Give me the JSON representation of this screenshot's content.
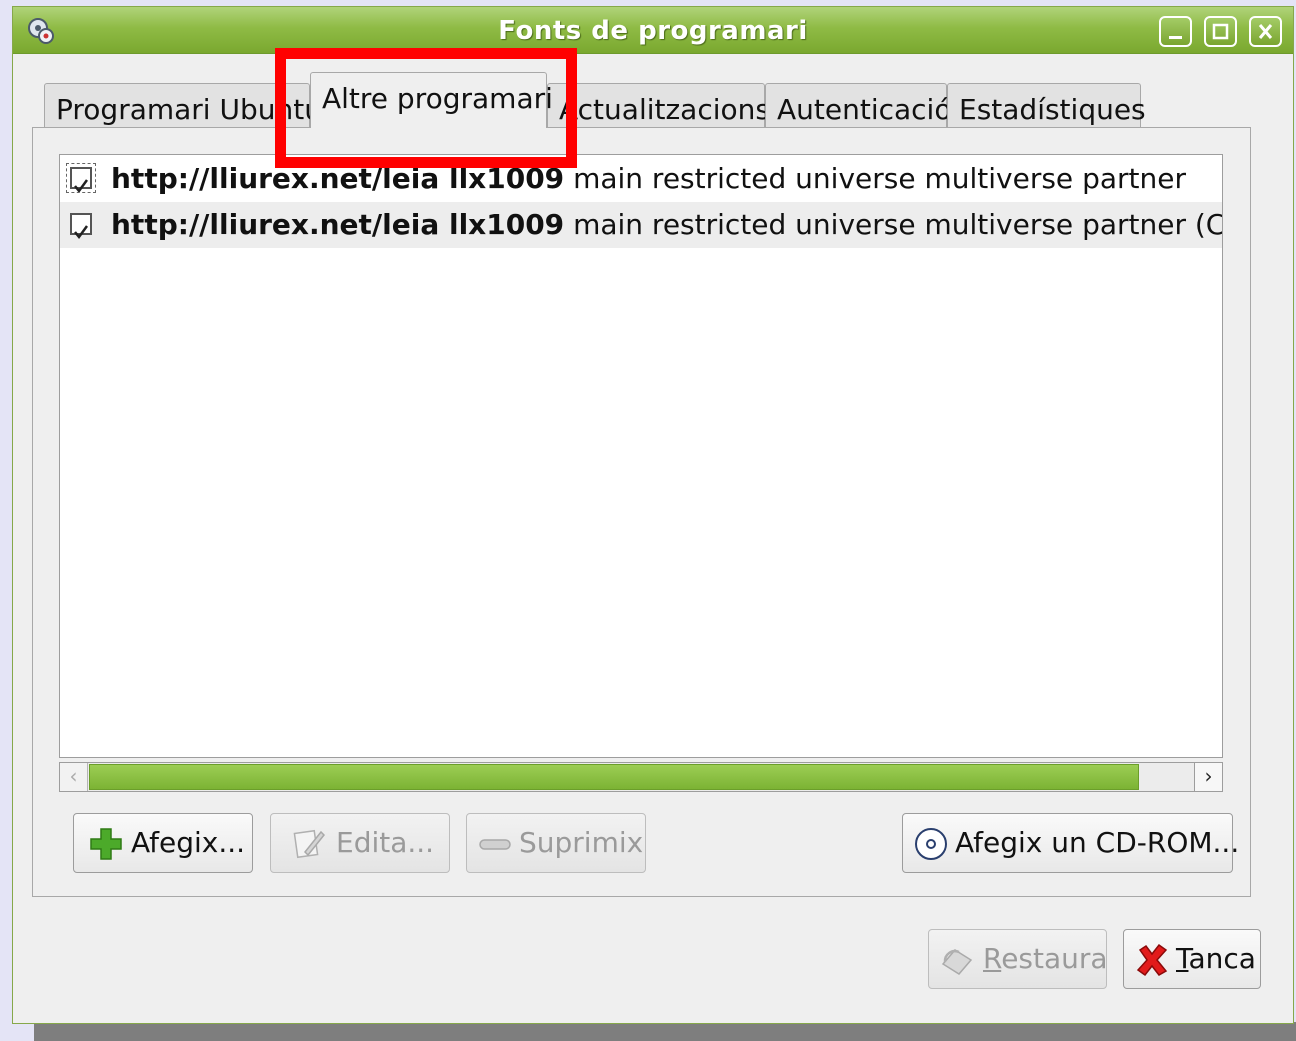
{
  "window": {
    "title": "Fonts de programari"
  },
  "tabs": [
    {
      "label": "Programari Ubuntu"
    },
    {
      "label": "Altre programari",
      "active": true
    },
    {
      "label": "Actualitzacions"
    },
    {
      "label": "Autenticació"
    },
    {
      "label": "Estadístiques"
    }
  ],
  "sources": [
    {
      "checked": true,
      "url": "http://lliurex.net/leia llx1009",
      "components": " main restricted universe multiverse partner"
    },
    {
      "checked": true,
      "url": "http://lliurex.net/leia llx1009",
      "components": " main restricted universe multiverse partner (Codi font)"
    }
  ],
  "buttons": {
    "add": "Afegix...",
    "edit": "Edita...",
    "remove": "Suprimix",
    "add_cdrom": "Afegix un CD-ROM...",
    "revert": "Restaura",
    "close": "Tanca"
  },
  "colors": {
    "accent_green": "#8fbb45",
    "highlight_red": "#ff0000"
  }
}
